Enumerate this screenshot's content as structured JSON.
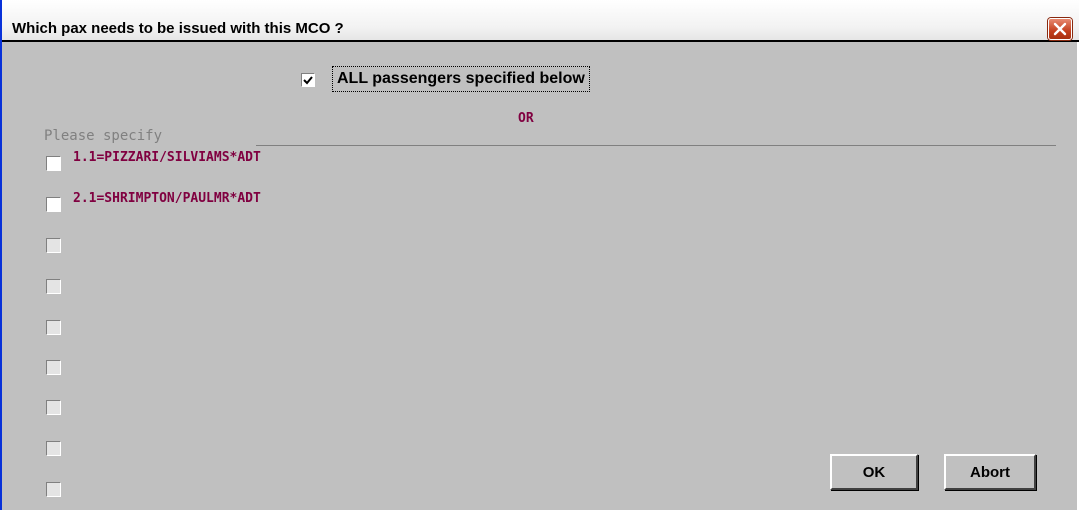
{
  "window": {
    "title": "Which pax needs to be issued with this MCO ?",
    "close_icon": "close-icon"
  },
  "all_passengers": {
    "label": "ALL passengers specified below",
    "checked": true
  },
  "or_label": "OR",
  "specify_label": "Please specify",
  "passengers": [
    {
      "label": "1.1=PIZZARI/SILVIAMS*ADT",
      "checked": false
    },
    {
      "label": "2.1=SHRIMPTON/PAULMR*ADT",
      "checked": false
    }
  ],
  "empty_slots": 7,
  "buttons": {
    "ok": "OK",
    "abort": "Abort"
  },
  "colors": {
    "window_bg": "#c0c0c0",
    "passenger_text": "#800040",
    "close_button": "#c33f1d"
  }
}
